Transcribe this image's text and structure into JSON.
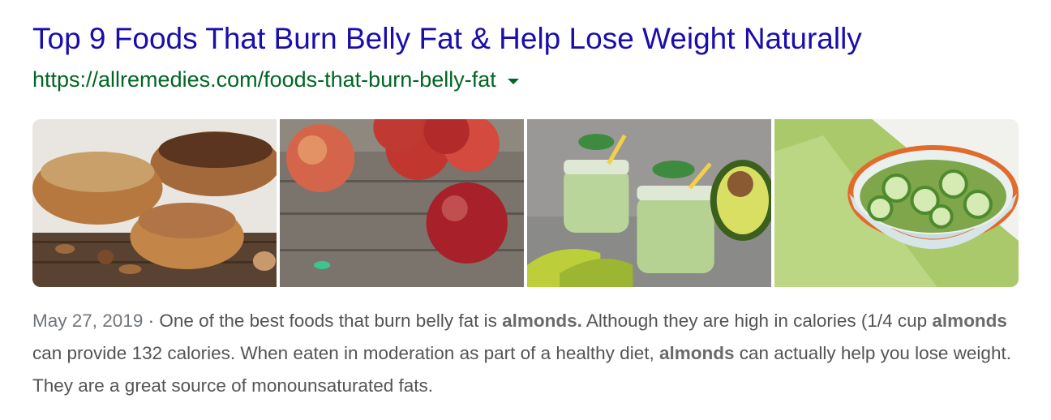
{
  "result": {
    "title": "Top 9 Foods That Burn Belly Fat & Help Lose Weight Naturally",
    "url": "https://allremedies.com/foods-that-burn-belly-fat",
    "date": "May 27, 2019",
    "separator": " · ",
    "snippet": {
      "p1": "One of the best foods that burn belly fat is ",
      "b1": "almonds.",
      "p2": " Although they are high in calories (1/4 cup ",
      "b2": "almonds",
      "p3": " can provide 132 calories. When eaten in moderation as part of a healthy diet, ",
      "b3": "almonds",
      "p4": " can actually help you lose weight. They are a great source of monounsaturated fats."
    }
  },
  "images": [
    {
      "subject": "nuts-in-wooden-bowls"
    },
    {
      "subject": "red-apples-on-wood"
    },
    {
      "subject": "avocado-smoothie-jars"
    },
    {
      "subject": "cucumber-salad-bowl"
    }
  ],
  "colors": {
    "title": "#1a0dab",
    "url": "#006621",
    "text": "#545454"
  },
  "icons": {
    "url_menu": "caret-down-icon"
  }
}
